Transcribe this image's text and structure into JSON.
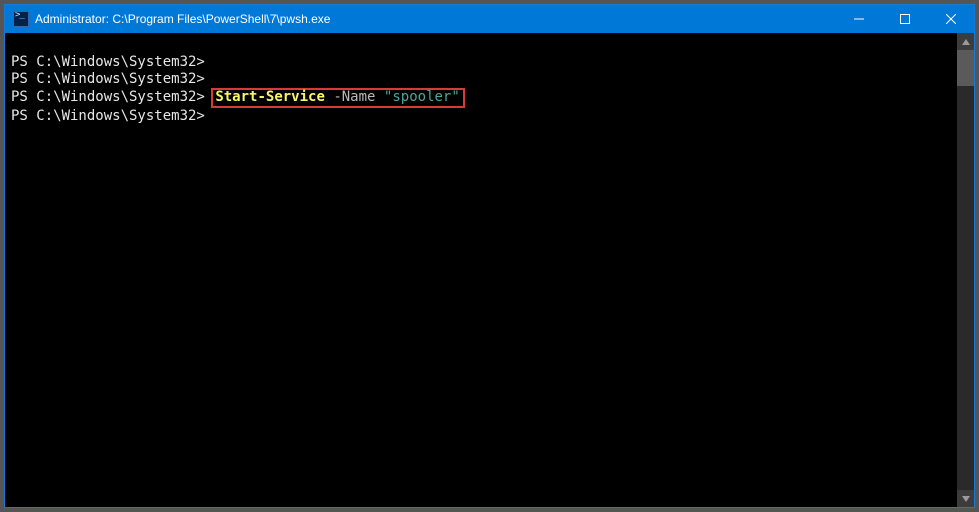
{
  "window": {
    "title": "Administrator: C:\\Program Files\\PowerShell\\7\\pwsh.exe"
  },
  "terminal": {
    "lines": [
      {
        "prompt": "PS C:\\Windows\\System32>",
        "command": ""
      },
      {
        "prompt": "PS C:\\Windows\\System32>",
        "command": ""
      },
      {
        "prompt": "PS C:\\Windows\\System32>",
        "cmdlet": "Start-Service",
        "param": "-Name",
        "string": "\"spooler\""
      },
      {
        "prompt": "PS C:\\Windows\\System32>",
        "command": ""
      }
    ]
  }
}
